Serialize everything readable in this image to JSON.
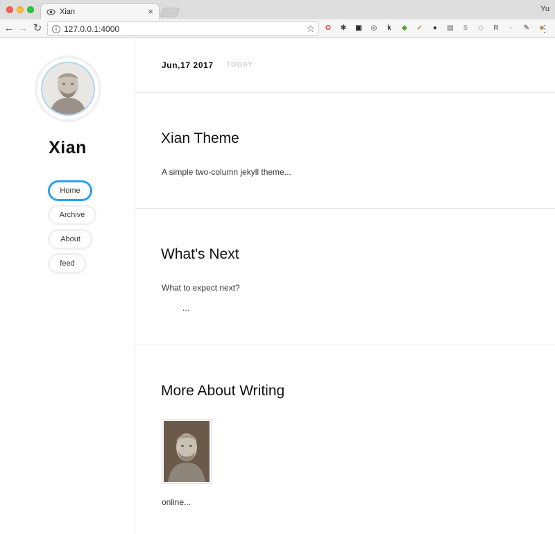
{
  "browser": {
    "tab_title": "Xian",
    "tab_close": "×",
    "profile": "Yu",
    "url": "127.0.0.1:4000",
    "info_glyph": "i",
    "extensions": [
      {
        "name": "opera-icon",
        "glyph": "O",
        "color": "#e2352b"
      },
      {
        "name": "sparkle-icon",
        "glyph": "✱",
        "color": "#444444"
      },
      {
        "name": "tab-icon",
        "glyph": "▣",
        "color": "#222222"
      },
      {
        "name": "ring-icon",
        "glyph": "◎",
        "color": "#8a8a8a"
      },
      {
        "name": "k-icon",
        "glyph": "k",
        "color": "#2b2b2b"
      },
      {
        "name": "leaf-icon",
        "glyph": "◆",
        "color": "#5aa33a"
      },
      {
        "name": "orange-check-icon",
        "glyph": "✓",
        "color": "#ef6c2c"
      },
      {
        "name": "penguin-icon",
        "glyph": "●",
        "color": "#333333"
      },
      {
        "name": "bars-icon",
        "glyph": "▤",
        "color": "#9a9a9a"
      },
      {
        "name": "s-icon",
        "glyph": "S",
        "color": "#a6a6a6"
      },
      {
        "name": "shield-icon",
        "glyph": "◇",
        "color": "#bcbcbc"
      },
      {
        "name": "r-icon",
        "glyph": "R",
        "color": "#7a7a7a"
      },
      {
        "name": "circle-icon",
        "glyph": "◐",
        "color": "#c8c8c8"
      },
      {
        "name": "pen-icon",
        "glyph": "✎",
        "color": "#8c8c8c"
      },
      {
        "name": "box-icon",
        "glyph": "■",
        "color": "#b88a4a"
      }
    ]
  },
  "sidebar": {
    "site_title": "Xian",
    "nav": [
      {
        "label": "Home",
        "active": true
      },
      {
        "label": "Archive",
        "active": false
      },
      {
        "label": "About",
        "active": false
      },
      {
        "label": "feed",
        "active": false
      }
    ]
  },
  "main": {
    "date": "Jun,17 2017",
    "today": "TODAY",
    "posts": [
      {
        "title": "Xian Theme",
        "excerpt": "A simple two-column jekyll theme..."
      },
      {
        "title": "What's Next",
        "excerpt": "What to expect next?",
        "extra": "..."
      },
      {
        "title": "More About Writing",
        "excerpt": "online..."
      }
    ]
  },
  "colors": {
    "accent": "#2a9ff0",
    "avatar_ring": "#a9d3ef"
  }
}
